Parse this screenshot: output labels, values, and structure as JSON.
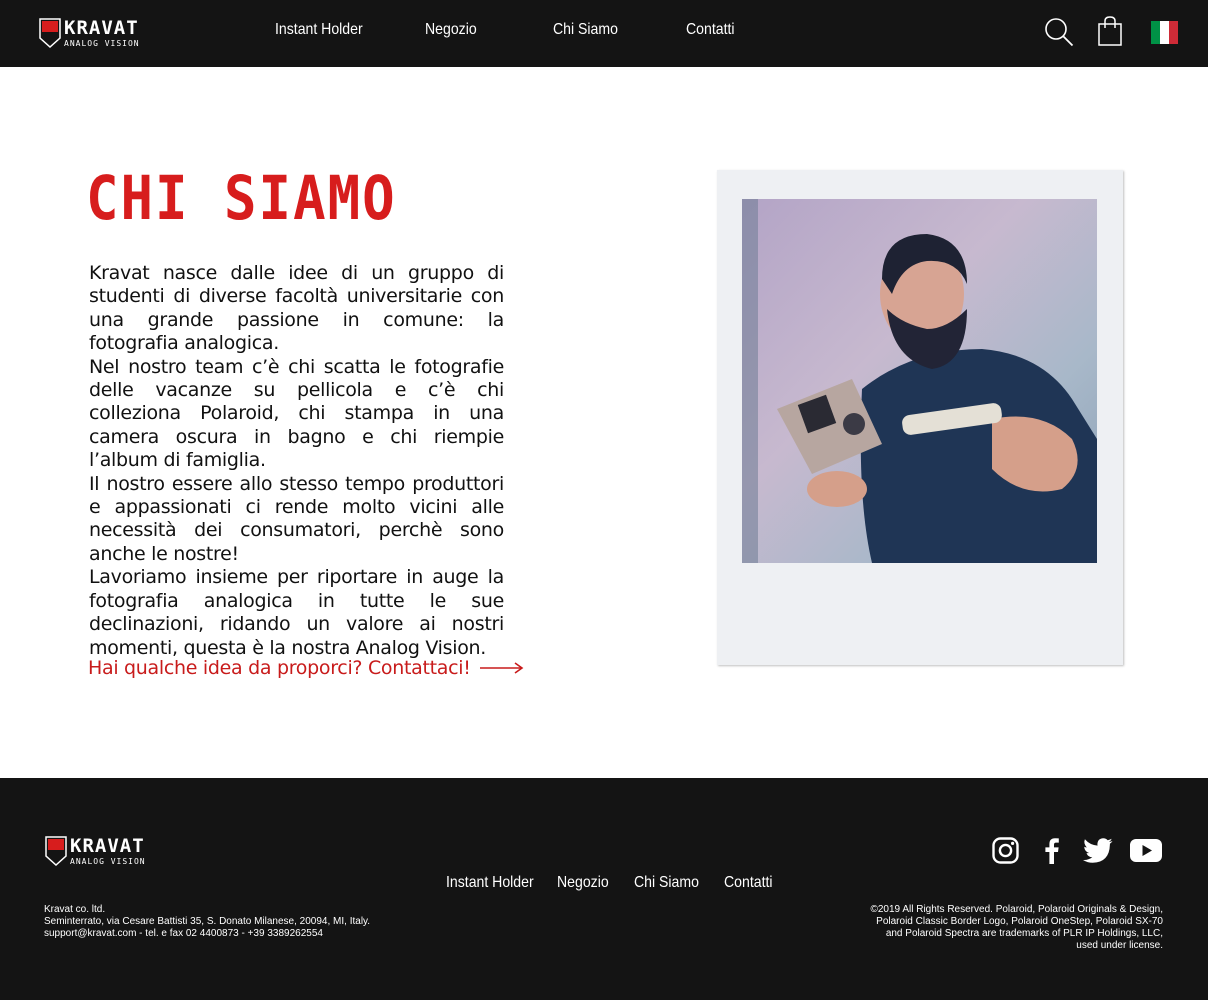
{
  "header": {
    "logo": {
      "brand": "KRAVAT",
      "tagline": "ANALOG VISION"
    },
    "nav": [
      "Instant Holder",
      "Negozio",
      "Chi Siamo",
      "Contatti"
    ],
    "icons": {
      "search": "search-icon",
      "cart": "shopping-bag-icon",
      "language": "italian-flag-icon"
    }
  },
  "main": {
    "title": "CHI SIAMO",
    "paragraphs": [
      "Kravat nasce dalle idee di un gruppo di studenti di diverse facoltà universitarie con una grande passione in comune: la fotografia analogica.",
      "Nel nostro team c’è chi scatta le fotografie delle vacanze su pellicola e c’è chi colleziona Polaroid, chi stampa in una camera oscura in bagno e chi riempie l’album di famiglia.",
      "Il nostro essere allo stesso tempo produttori e appassionati ci rende molto vicini alle necessità dei consumatori, perchè sono anche le nostre!",
      "Lavoriamo insieme per riportare in auge la fotografia analogica in tutte le sue declinazioni, ridando un valore ai nostri momenti, questa è la nostra Analog Vision."
    ],
    "cta": "Hai qualche idea da proporci? Contattaci!"
  },
  "footer": {
    "logo": {
      "brand": "KRAVAT",
      "tagline": "ANALOG VISION"
    },
    "nav": [
      "Instant Holder",
      "Negozio",
      "Chi Siamo",
      "Contatti"
    ],
    "company": [
      "Kravat  co. ltd.",
      "Seminterrato, via Cesare Battisti 35, S. Donato Milanese, 20094, MI, Italy.",
      "support@kravat.com - tel. e fax 02 4400873 - +39 3389262554"
    ],
    "legal": [
      "©2019 All Rights Reserved. Polaroid, Polaroid Originals & Design,",
      "Polaroid Classic Border Logo, Polaroid OneStep, Polaroid SX-70",
      "and Polaroid Spectra are trademarks of PLR IP Holdings, LLC,",
      "used under license."
    ],
    "social": [
      "instagram-icon",
      "facebook-icon",
      "twitter-icon",
      "youtube-icon"
    ]
  },
  "colors": {
    "accent": "#d71d1d",
    "dark": "#141414",
    "flag_green": "#009246",
    "flag_white": "#ffffff",
    "flag_red": "#ce2b37"
  }
}
